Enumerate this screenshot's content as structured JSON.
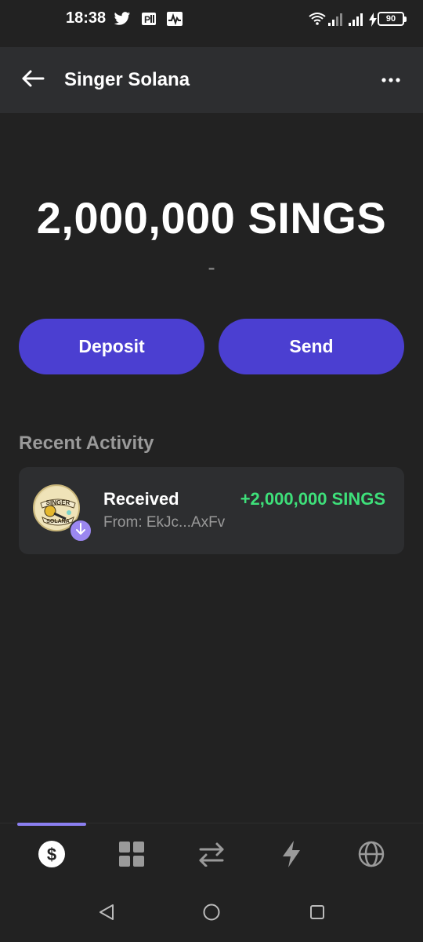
{
  "status_bar": {
    "time": "18:38",
    "battery": "90",
    "icons": [
      "twitter-icon",
      "parking-app-icon",
      "activity-app-icon",
      "wifi-icon",
      "signal-icon",
      "signal-icon",
      "charging-icon",
      "battery-icon"
    ]
  },
  "header": {
    "title": "Singer Solana",
    "back_icon": "arrow-left-icon",
    "menu_icon": "more-horizontal-icon"
  },
  "balance": {
    "amount": "2,000,000 SINGS",
    "fiat_value": "-"
  },
  "actions": {
    "deposit_label": "Deposit",
    "send_label": "Send"
  },
  "recent_activity": {
    "title": "Recent Activity",
    "items": [
      {
        "label": "Received",
        "from": "From: EkJc...AxFv",
        "amount": "+2,000,000 SINGS",
        "token_logo": "singer-solana-logo",
        "badge_icon": "arrow-down-icon"
      }
    ]
  },
  "bottom_nav": {
    "items": [
      "dollar-icon",
      "grid-icon",
      "swap-icon",
      "lightning-icon",
      "globe-icon"
    ],
    "active_index": 0
  },
  "colors": {
    "background": "#222222",
    "surface": "#2d2e30",
    "accent": "#4b3fd1",
    "positive": "#3ee07a",
    "badge": "#9b87f0",
    "muted_text": "#9a9a9a"
  }
}
